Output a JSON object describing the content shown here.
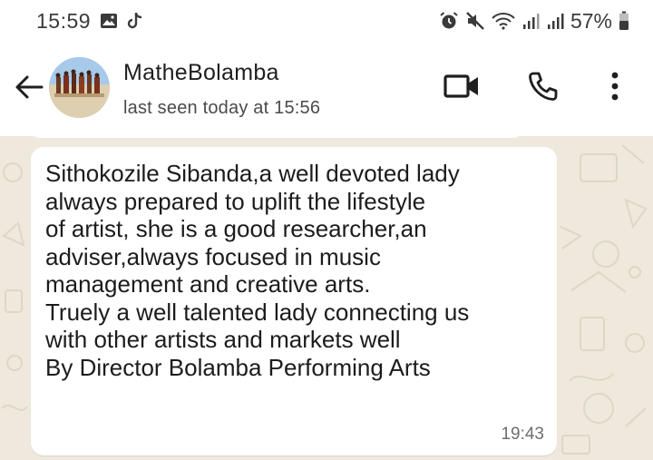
{
  "status_bar": {
    "time": "15:59",
    "battery": "57%",
    "left_icons": [
      "gallery-icon",
      "tiktok-icon"
    ],
    "right_icons": [
      "alarm-icon",
      "mute-icon",
      "wifi-icon",
      "signal-icon",
      "signal-icon",
      "battery-icon"
    ]
  },
  "header": {
    "contact_name": "MatheBolamba",
    "last_seen": "last seen today at 15:56",
    "icons": [
      "back-arrow-icon",
      "video-call-icon",
      "phone-icon",
      "more-vertical-icon"
    ]
  },
  "message": {
    "text": "Sithokozile Sibanda,a well devoted lady\nalways prepared to uplift the lifestyle\nof artist, she is a good researcher,an\nadviser,always focused in music\nmanagement and creative arts.\nTruely a well talented lady connecting us\nwith other artists and markets well\nBy Director Bolamba Performing Arts",
    "time": "19:43"
  },
  "colors": {
    "chat_background": "#efe8dc",
    "bubble": "#ffffff",
    "text": "#1c1c1c"
  }
}
